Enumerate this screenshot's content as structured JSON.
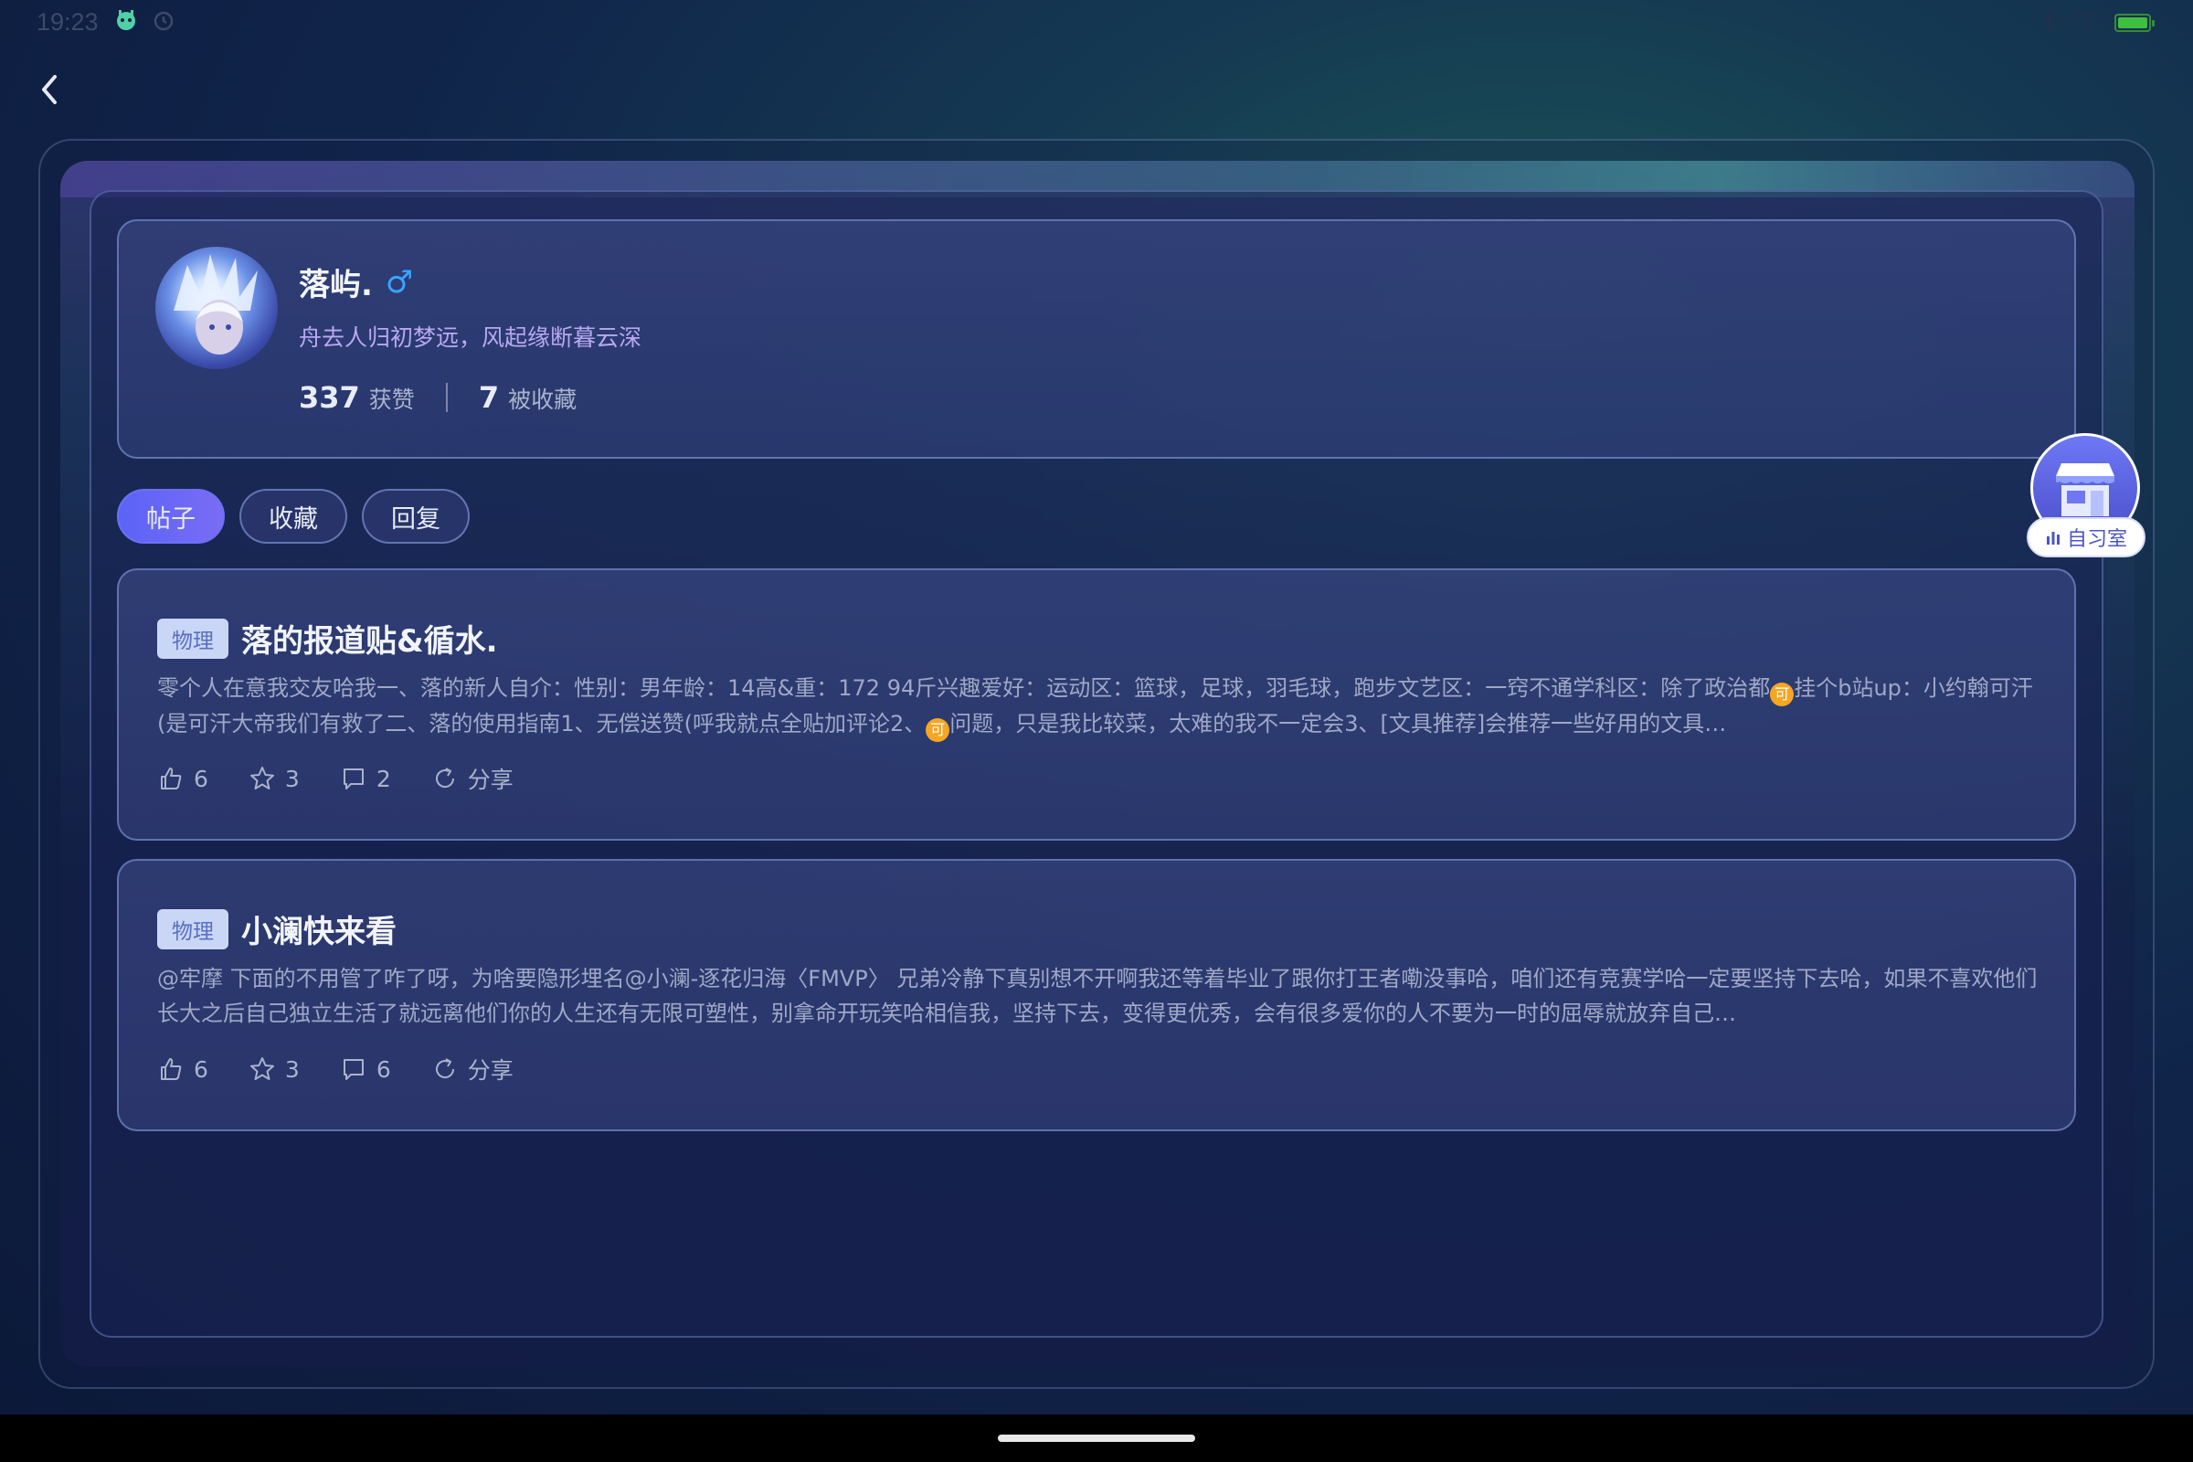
{
  "status_bar": {
    "time": "19:23",
    "icons_left": [
      "app-notification-icon",
      "alarm-icon"
    ],
    "icons_right": [
      "bluetooth-icon",
      "wifi-icon",
      "battery-icon"
    ]
  },
  "profile": {
    "name": "落屿.",
    "gender_symbol": "♂",
    "bio": "舟去人归初梦远，风起缘断暮云深",
    "likes_count": "337",
    "likes_label": "获赞",
    "favorited_count": "7",
    "favorited_label": "被收藏"
  },
  "tabs": [
    {
      "label": "帖子",
      "active": true
    },
    {
      "label": "收藏",
      "active": false
    },
    {
      "label": "回复",
      "active": false
    }
  ],
  "posts": [
    {
      "tag": "物理",
      "title": "落的报道贴&循水.",
      "body_part1": "零个人在意我交友哈我一、落的新人自介：性别：男年龄：14高&重：172 94斤兴趣爱好：运动区：篮球，足球，羽毛球，跑步文艺区：一窍不通学科区：除了政治都",
      "emoji": "可",
      "body_part2": "挂个b站up：小约翰可汗(是可汗大帝我们有救了二、落的使用指南1、无偿送赞(呼我就点全贴加评论2、",
      "body_part3": "问题，只是我比较菜，太难的我不一定会3、[文具推荐]会推荐一些好用的文具…",
      "likes": "6",
      "stars": "3",
      "comments": "2",
      "share_label": "分享"
    },
    {
      "tag": "物理",
      "title": "小澜快来看",
      "body": "@牢摩 下面的不用管了咋了呀，为啥要隐形埋名@小澜-逐花归海〈FMVP〉 兄弟冷静下真别想不开啊我还等着毕业了跟你打王者嘞没事哈，咱们还有竞赛学哈一定要坚持下去哈，如果不喜欢他们长大之后自己独立生活了就远离他们你的人生还有无限可塑性，别拿命开玩笑哈相信我，坚持下去，变得更优秀，会有很多爱你的人不要为一时的屈辱就放弃自己…",
      "likes": "6",
      "stars": "3",
      "comments": "6",
      "share_label": "分享"
    }
  ],
  "floating_widget": {
    "label": "自习室"
  },
  "colors": {
    "accent": "#5b63f5",
    "male": "#3aa3ff",
    "bio": "#b9a8f0"
  }
}
